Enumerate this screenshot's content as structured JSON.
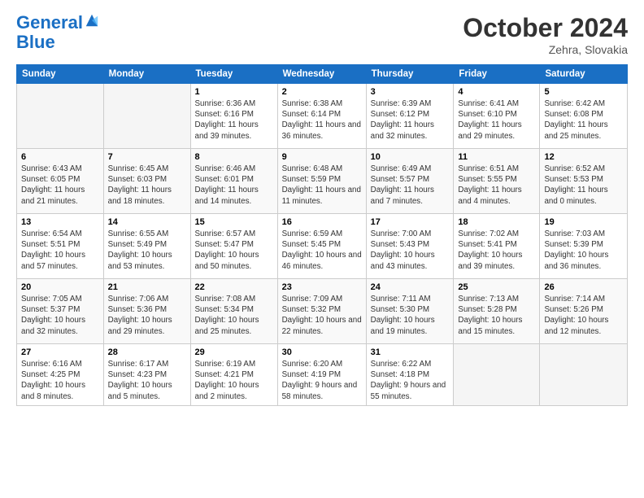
{
  "header": {
    "logo_line1": "General",
    "logo_line2": "Blue",
    "month": "October 2024",
    "location": "Zehra, Slovakia"
  },
  "days_of_week": [
    "Sunday",
    "Monday",
    "Tuesday",
    "Wednesday",
    "Thursday",
    "Friday",
    "Saturday"
  ],
  "weeks": [
    [
      {
        "num": "",
        "info": ""
      },
      {
        "num": "",
        "info": ""
      },
      {
        "num": "1",
        "info": "Sunrise: 6:36 AM\nSunset: 6:16 PM\nDaylight: 11 hours and 39 minutes."
      },
      {
        "num": "2",
        "info": "Sunrise: 6:38 AM\nSunset: 6:14 PM\nDaylight: 11 hours and 36 minutes."
      },
      {
        "num": "3",
        "info": "Sunrise: 6:39 AM\nSunset: 6:12 PM\nDaylight: 11 hours and 32 minutes."
      },
      {
        "num": "4",
        "info": "Sunrise: 6:41 AM\nSunset: 6:10 PM\nDaylight: 11 hours and 29 minutes."
      },
      {
        "num": "5",
        "info": "Sunrise: 6:42 AM\nSunset: 6:08 PM\nDaylight: 11 hours and 25 minutes."
      }
    ],
    [
      {
        "num": "6",
        "info": "Sunrise: 6:43 AM\nSunset: 6:05 PM\nDaylight: 11 hours and 21 minutes."
      },
      {
        "num": "7",
        "info": "Sunrise: 6:45 AM\nSunset: 6:03 PM\nDaylight: 11 hours and 18 minutes."
      },
      {
        "num": "8",
        "info": "Sunrise: 6:46 AM\nSunset: 6:01 PM\nDaylight: 11 hours and 14 minutes."
      },
      {
        "num": "9",
        "info": "Sunrise: 6:48 AM\nSunset: 5:59 PM\nDaylight: 11 hours and 11 minutes."
      },
      {
        "num": "10",
        "info": "Sunrise: 6:49 AM\nSunset: 5:57 PM\nDaylight: 11 hours and 7 minutes."
      },
      {
        "num": "11",
        "info": "Sunrise: 6:51 AM\nSunset: 5:55 PM\nDaylight: 11 hours and 4 minutes."
      },
      {
        "num": "12",
        "info": "Sunrise: 6:52 AM\nSunset: 5:53 PM\nDaylight: 11 hours and 0 minutes."
      }
    ],
    [
      {
        "num": "13",
        "info": "Sunrise: 6:54 AM\nSunset: 5:51 PM\nDaylight: 10 hours and 57 minutes."
      },
      {
        "num": "14",
        "info": "Sunrise: 6:55 AM\nSunset: 5:49 PM\nDaylight: 10 hours and 53 minutes."
      },
      {
        "num": "15",
        "info": "Sunrise: 6:57 AM\nSunset: 5:47 PM\nDaylight: 10 hours and 50 minutes."
      },
      {
        "num": "16",
        "info": "Sunrise: 6:59 AM\nSunset: 5:45 PM\nDaylight: 10 hours and 46 minutes."
      },
      {
        "num": "17",
        "info": "Sunrise: 7:00 AM\nSunset: 5:43 PM\nDaylight: 10 hours and 43 minutes."
      },
      {
        "num": "18",
        "info": "Sunrise: 7:02 AM\nSunset: 5:41 PM\nDaylight: 10 hours and 39 minutes."
      },
      {
        "num": "19",
        "info": "Sunrise: 7:03 AM\nSunset: 5:39 PM\nDaylight: 10 hours and 36 minutes."
      }
    ],
    [
      {
        "num": "20",
        "info": "Sunrise: 7:05 AM\nSunset: 5:37 PM\nDaylight: 10 hours and 32 minutes."
      },
      {
        "num": "21",
        "info": "Sunrise: 7:06 AM\nSunset: 5:36 PM\nDaylight: 10 hours and 29 minutes."
      },
      {
        "num": "22",
        "info": "Sunrise: 7:08 AM\nSunset: 5:34 PM\nDaylight: 10 hours and 25 minutes."
      },
      {
        "num": "23",
        "info": "Sunrise: 7:09 AM\nSunset: 5:32 PM\nDaylight: 10 hours and 22 minutes."
      },
      {
        "num": "24",
        "info": "Sunrise: 7:11 AM\nSunset: 5:30 PM\nDaylight: 10 hours and 19 minutes."
      },
      {
        "num": "25",
        "info": "Sunrise: 7:13 AM\nSunset: 5:28 PM\nDaylight: 10 hours and 15 minutes."
      },
      {
        "num": "26",
        "info": "Sunrise: 7:14 AM\nSunset: 5:26 PM\nDaylight: 10 hours and 12 minutes."
      }
    ],
    [
      {
        "num": "27",
        "info": "Sunrise: 6:16 AM\nSunset: 4:25 PM\nDaylight: 10 hours and 8 minutes."
      },
      {
        "num": "28",
        "info": "Sunrise: 6:17 AM\nSunset: 4:23 PM\nDaylight: 10 hours and 5 minutes."
      },
      {
        "num": "29",
        "info": "Sunrise: 6:19 AM\nSunset: 4:21 PM\nDaylight: 10 hours and 2 minutes."
      },
      {
        "num": "30",
        "info": "Sunrise: 6:20 AM\nSunset: 4:19 PM\nDaylight: 9 hours and 58 minutes."
      },
      {
        "num": "31",
        "info": "Sunrise: 6:22 AM\nSunset: 4:18 PM\nDaylight: 9 hours and 55 minutes."
      },
      {
        "num": "",
        "info": ""
      },
      {
        "num": "",
        "info": ""
      }
    ]
  ]
}
